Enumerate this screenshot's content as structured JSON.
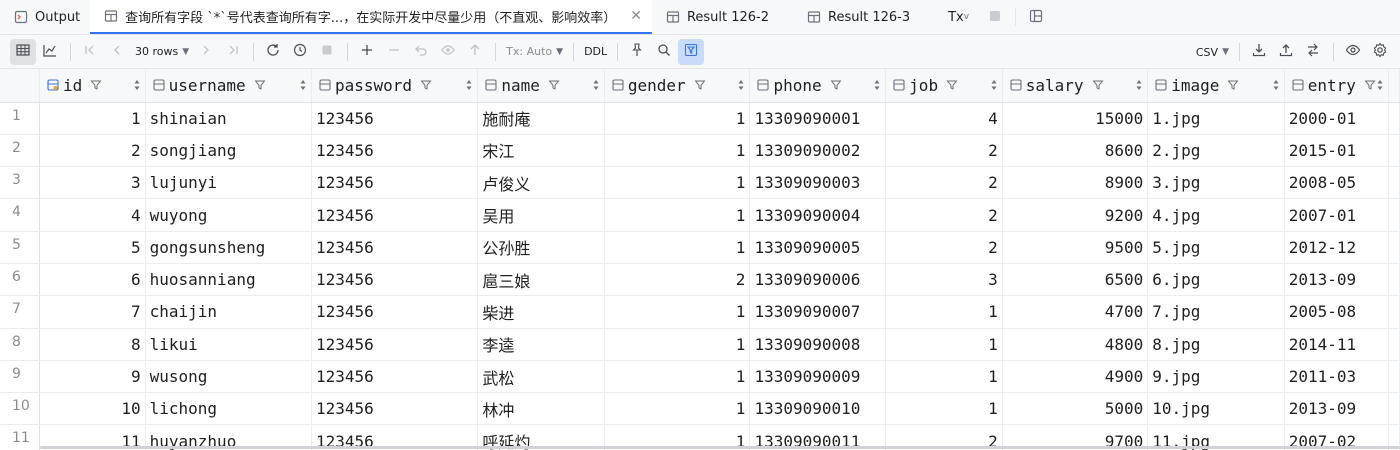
{
  "tabs": [
    {
      "label": "Output",
      "icon": "output-icon",
      "active": false,
      "closable": false
    },
    {
      "label": "查询所有字段 `*`号代表查询所有字...，在实际开发中尽量少用（不直观、影响效率）",
      "icon": "table-icon",
      "active": true,
      "closable": true
    },
    {
      "label": "Result 126-2",
      "icon": "table-icon",
      "active": false,
      "closable": false
    },
    {
      "label": "Result 126-3",
      "icon": "table-icon",
      "active": false,
      "closable": false
    },
    {
      "label": "Tx",
      "icon": "",
      "active": false,
      "closable": false
    }
  ],
  "toolbar": {
    "rows_label": "30 rows",
    "tx_label": "Tx: Auto",
    "ddl_label": "DDL",
    "export_label": "CSV"
  },
  "colors": {
    "accent": "#3574f0",
    "header_bg": "#f7f8fa",
    "grid_line": "#ebecf0"
  },
  "columns": [
    {
      "name": "id",
      "icon": "key-column-icon",
      "align": "right"
    },
    {
      "name": "username",
      "icon": "column-icon",
      "align": "left"
    },
    {
      "name": "password",
      "icon": "column-icon",
      "align": "left"
    },
    {
      "name": "name",
      "icon": "column-icon",
      "align": "left"
    },
    {
      "name": "gender",
      "icon": "column-icon",
      "align": "right"
    },
    {
      "name": "phone",
      "icon": "column-icon",
      "align": "left"
    },
    {
      "name": "job",
      "icon": "column-icon",
      "align": "right"
    },
    {
      "name": "salary",
      "icon": "column-icon",
      "align": "right"
    },
    {
      "name": "image",
      "icon": "column-icon",
      "align": "left"
    },
    {
      "name": "entry",
      "icon": "column-icon",
      "align": "left"
    }
  ],
  "rows": [
    {
      "n": "1",
      "cells": [
        "1",
        "shinaian",
        "123456",
        "施耐庵",
        "1",
        "13309090001",
        "4",
        "15000",
        "1.jpg",
        "2000-01"
      ]
    },
    {
      "n": "2",
      "cells": [
        "2",
        "songjiang",
        "123456",
        "宋江",
        "1",
        "13309090002",
        "2",
        "8600",
        "2.jpg",
        "2015-01"
      ]
    },
    {
      "n": "3",
      "cells": [
        "3",
        "lujunyi",
        "123456",
        "卢俊义",
        "1",
        "13309090003",
        "2",
        "8900",
        "3.jpg",
        "2008-05"
      ]
    },
    {
      "n": "4",
      "cells": [
        "4",
        "wuyong",
        "123456",
        "吴用",
        "1",
        "13309090004",
        "2",
        "9200",
        "4.jpg",
        "2007-01"
      ]
    },
    {
      "n": "5",
      "cells": [
        "5",
        "gongsunsheng",
        "123456",
        "公孙胜",
        "1",
        "13309090005",
        "2",
        "9500",
        "5.jpg",
        "2012-12"
      ]
    },
    {
      "n": "6",
      "cells": [
        "6",
        "huosanniang",
        "123456",
        "扈三娘",
        "2",
        "13309090006",
        "3",
        "6500",
        "6.jpg",
        "2013-09"
      ]
    },
    {
      "n": "7",
      "cells": [
        "7",
        "chaijin",
        "123456",
        "柴进",
        "1",
        "13309090007",
        "1",
        "4700",
        "7.jpg",
        "2005-08"
      ]
    },
    {
      "n": "8",
      "cells": [
        "8",
        "likui",
        "123456",
        "李逵",
        "1",
        "13309090008",
        "1",
        "4800",
        "8.jpg",
        "2014-11"
      ]
    },
    {
      "n": "9",
      "cells": [
        "9",
        "wusong",
        "123456",
        "武松",
        "1",
        "13309090009",
        "1",
        "4900",
        "9.jpg",
        "2011-03"
      ]
    },
    {
      "n": "10",
      "cells": [
        "10",
        "lichong",
        "123456",
        "林冲",
        "1",
        "13309090010",
        "1",
        "5000",
        "10.jpg",
        "2013-09"
      ]
    },
    {
      "n": "11",
      "cells": [
        "11",
        "huyanzhuo",
        "123456",
        "呼延灼",
        "1",
        "13309090011",
        "2",
        "9700",
        "11.jpg",
        "2007-02"
      ]
    }
  ]
}
